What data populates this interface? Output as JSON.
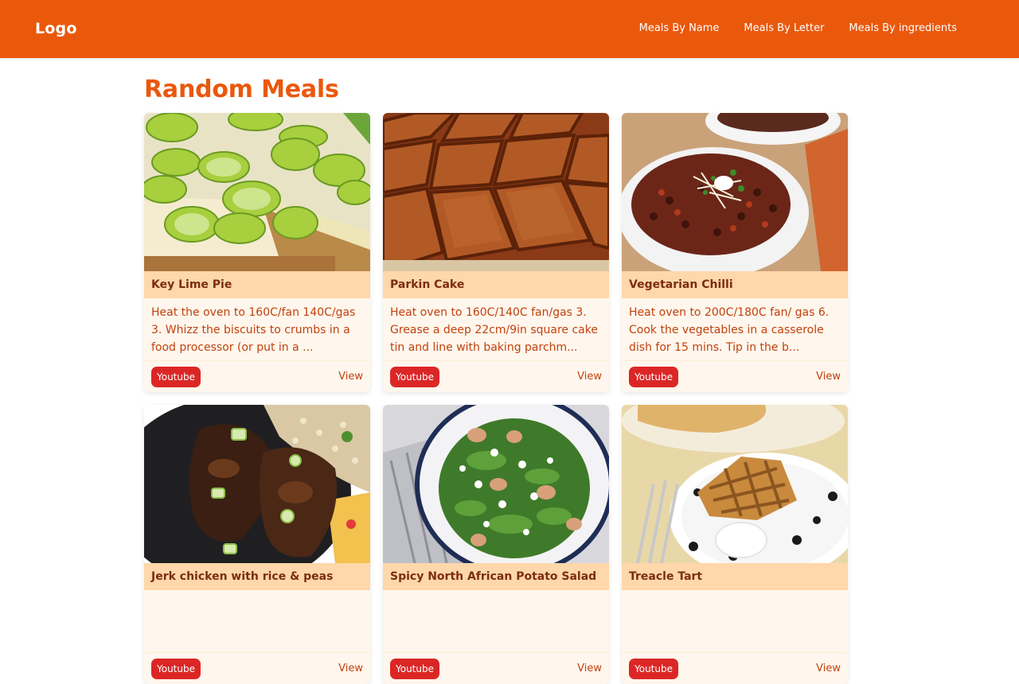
{
  "header": {
    "logo": "Logo",
    "nav": [
      "Meals By Name",
      "Meals By Letter",
      "Meals By ingredients"
    ]
  },
  "main": {
    "title": "Random Meals",
    "meals": [
      {
        "name": "Key Lime Pie",
        "description": "Heat the oven to 160C/fan 140C/gas 3. Whizz the biscuits to crumbs in a food processor (or put in a ...",
        "youtube_label": "Youtube",
        "view_label": "View"
      },
      {
        "name": "Parkin Cake",
        "description": "Heat oven to 160C/140C fan/gas 3. Grease a deep 22cm/9in square cake tin and line with baking parchm...",
        "youtube_label": "Youtube",
        "view_label": "View"
      },
      {
        "name": "Vegetarian Chilli",
        "description": "Heat oven to 200C/180C fan/ gas 6. Cook the vegetables in a casserole dish for 15 mins. Tip in the b...",
        "youtube_label": "Youtube",
        "view_label": "View"
      },
      {
        "name": "Jerk chicken with rice & peas",
        "description": "",
        "youtube_label": "Youtube",
        "view_label": "View"
      },
      {
        "name": "Spicy North African Potato Salad",
        "description": "",
        "youtube_label": "Youtube",
        "view_label": "View"
      },
      {
        "name": "Treacle Tart",
        "description": "",
        "youtube_label": "Youtube",
        "view_label": "View"
      }
    ]
  },
  "colors": {
    "header_bg": "#ea580c",
    "title": "#ea580c",
    "card_bg": "#fff7ed",
    "card_title_bg": "#fed7aa",
    "card_title_text": "#7c2d12",
    "description_text": "#c2410c",
    "youtube_button": "#dc2626"
  }
}
